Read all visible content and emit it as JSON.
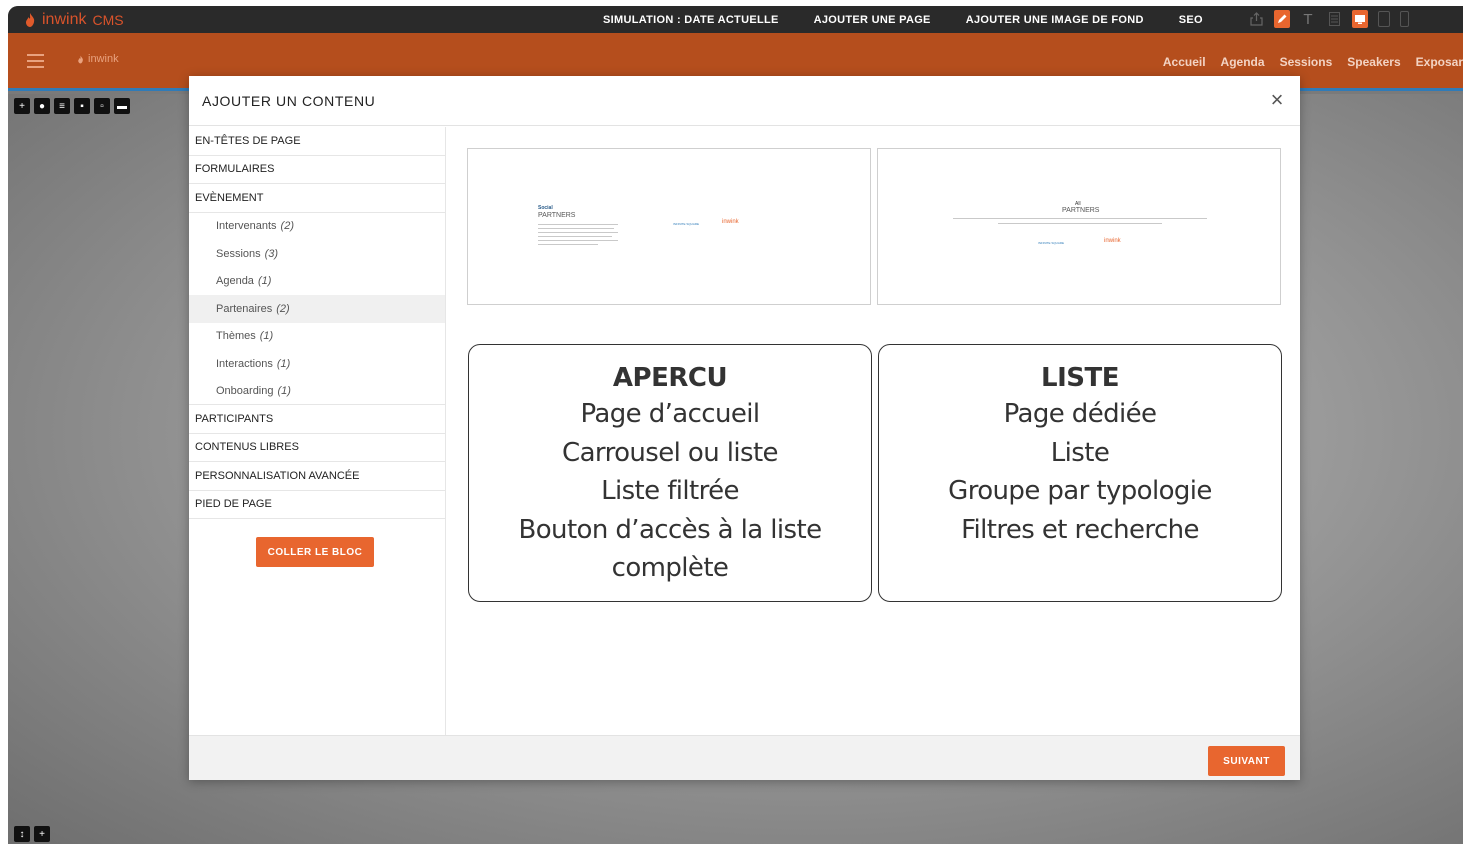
{
  "cms_bar": {
    "brand": "inwink",
    "product": "CMS",
    "menu": [
      "SIMULATION : DATE ACTUELLE",
      "AJOUTER UNE PAGE",
      "AJOUTER UNE IMAGE DE FOND",
      "SEO"
    ]
  },
  "site": {
    "mini_logo": "inwink",
    "nav": [
      "Accueil",
      "Agenda",
      "Sessions",
      "Speakers",
      "Exposar"
    ]
  },
  "modal": {
    "title": "AJOUTER UN CONTENU",
    "close": "×",
    "categories": [
      {
        "label": "EN-TÊTES DE PAGE"
      },
      {
        "label": "FORMULAIRES"
      },
      {
        "label": "EVÈNEMENT",
        "items": [
          {
            "label": "Intervenants",
            "count": "(2)"
          },
          {
            "label": "Sessions",
            "count": "(3)"
          },
          {
            "label": "Agenda",
            "count": "(1)"
          },
          {
            "label": "Partenaires",
            "count": "(2)",
            "selected": true
          },
          {
            "label": "Thèmes",
            "count": "(1)"
          },
          {
            "label": "Interactions",
            "count": "(1)"
          },
          {
            "label": "Onboarding",
            "count": "(1)"
          }
        ]
      },
      {
        "label": "PARTICIPANTS"
      },
      {
        "label": "CONTENUS LIBRES"
      },
      {
        "label": "PERSONNALISATION AVANCÉE"
      },
      {
        "label": "PIED DE PAGE"
      }
    ],
    "paste_button": "COLLER LE BLOC",
    "next_button": "SUIVANT",
    "previews": [
      {
        "small_title": "Social",
        "title": "PARTNERS",
        "logos": [
          "INFINITE SQUARE",
          "inwink"
        ]
      },
      {
        "small_title": "All",
        "title": "PARTNERS",
        "logos": [
          "INFINITE SQUARE",
          "inwink"
        ]
      }
    ],
    "descriptions": [
      {
        "heading": "APERCU",
        "lines": [
          "Page d’accueil",
          "Carrousel ou liste",
          "Liste filtrée",
          "Bouton d’accès à la liste",
          "complète"
        ]
      },
      {
        "heading": "LISTE",
        "lines": [
          "Page dédiée",
          "Liste",
          "Groupe par typologie",
          "Filtres et recherche"
        ]
      }
    ]
  },
  "colors": {
    "accent": "#e8662f",
    "cms_bar": "#2a2a2a",
    "site_header": "#b54e1d",
    "header_border": "#2f7bb8"
  }
}
